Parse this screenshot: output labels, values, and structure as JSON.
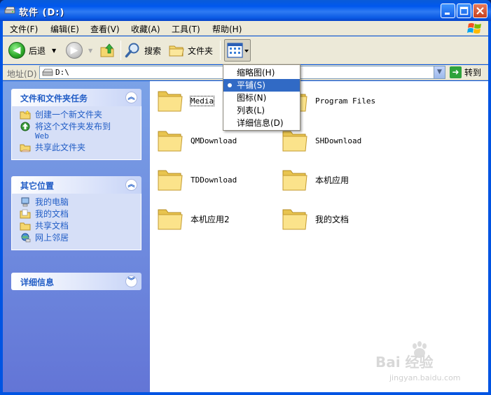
{
  "window": {
    "title": "软件  (D:)",
    "buttons": {
      "minimize": "minimize-icon",
      "maximize": "maximize-icon",
      "close": "close-icon"
    }
  },
  "menubar": {
    "items": [
      "文件(F)",
      "编辑(E)",
      "查看(V)",
      "收藏(A)",
      "工具(T)",
      "帮助(H)"
    ]
  },
  "toolbar": {
    "back_label": "后退",
    "search_label": "搜索",
    "folders_label": "文件夹"
  },
  "address": {
    "label": "地址(D)",
    "value": "D:\\",
    "go_label": "转到"
  },
  "left_pane": {
    "panels": [
      {
        "title": "文件和文件夹任务",
        "toggle": "collapse-icon",
        "tasks": [
          {
            "label": "创建一个新文件夹",
            "icon": "new-folder-icon"
          },
          {
            "label": "将这个文件夹发布到",
            "label2": "Web",
            "icon": "publish-web-icon"
          },
          {
            "label": "共享此文件夹",
            "icon": "share-folder-icon"
          }
        ]
      },
      {
        "title": "其它位置",
        "toggle": "collapse-icon",
        "tasks": [
          {
            "label": "我的电脑",
            "icon": "my-computer-icon"
          },
          {
            "label": "我的文档",
            "icon": "my-documents-icon"
          },
          {
            "label": "共享文档",
            "icon": "shared-documents-icon"
          },
          {
            "label": "网上邻居",
            "icon": "network-places-icon"
          }
        ]
      },
      {
        "title": "详细信息",
        "toggle": "expand-icon",
        "tasks": []
      }
    ]
  },
  "content": {
    "items": [
      {
        "name": "Media"
      },
      {
        "name": "Program Files"
      },
      {
        "name": "QMDownload"
      },
      {
        "name": "SHDownload"
      },
      {
        "name": "TDDownload"
      },
      {
        "name": "本机应用"
      },
      {
        "name": "本机应用2"
      },
      {
        "name": "我的文档"
      }
    ]
  },
  "views_menu": {
    "items": [
      {
        "label": "缩略图(H)"
      },
      {
        "label": "平铺(S)",
        "selected": true
      },
      {
        "label": "图标(N)"
      },
      {
        "label": "列表(L)"
      },
      {
        "label": "详细信息(D)"
      }
    ]
  },
  "watermark": {
    "brand": "Bai 经验",
    "url": "jingyan.baidu.com"
  }
}
